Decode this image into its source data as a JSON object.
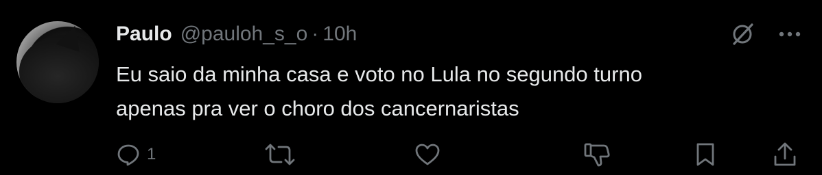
{
  "tweet": {
    "author_name": "Paulo",
    "author_handle": "@pauloh_s_o",
    "separator": "·",
    "time": "10h",
    "text_lines": [
      "Eu saio da minha casa e voto no Lula no segundo turno",
      "apenas pra ver o choro dos cancernaristas"
    ],
    "reply_count": "1"
  },
  "icons": {
    "top_right": [
      "grok-icon",
      "more-icon"
    ],
    "actions": [
      "reply-icon",
      "retweet-icon",
      "like-icon",
      "downvote-icon",
      "bookmark-icon",
      "share-icon"
    ]
  },
  "colors": {
    "background": "#000000",
    "text": "#e7e9ea",
    "secondary": "#71767b"
  }
}
